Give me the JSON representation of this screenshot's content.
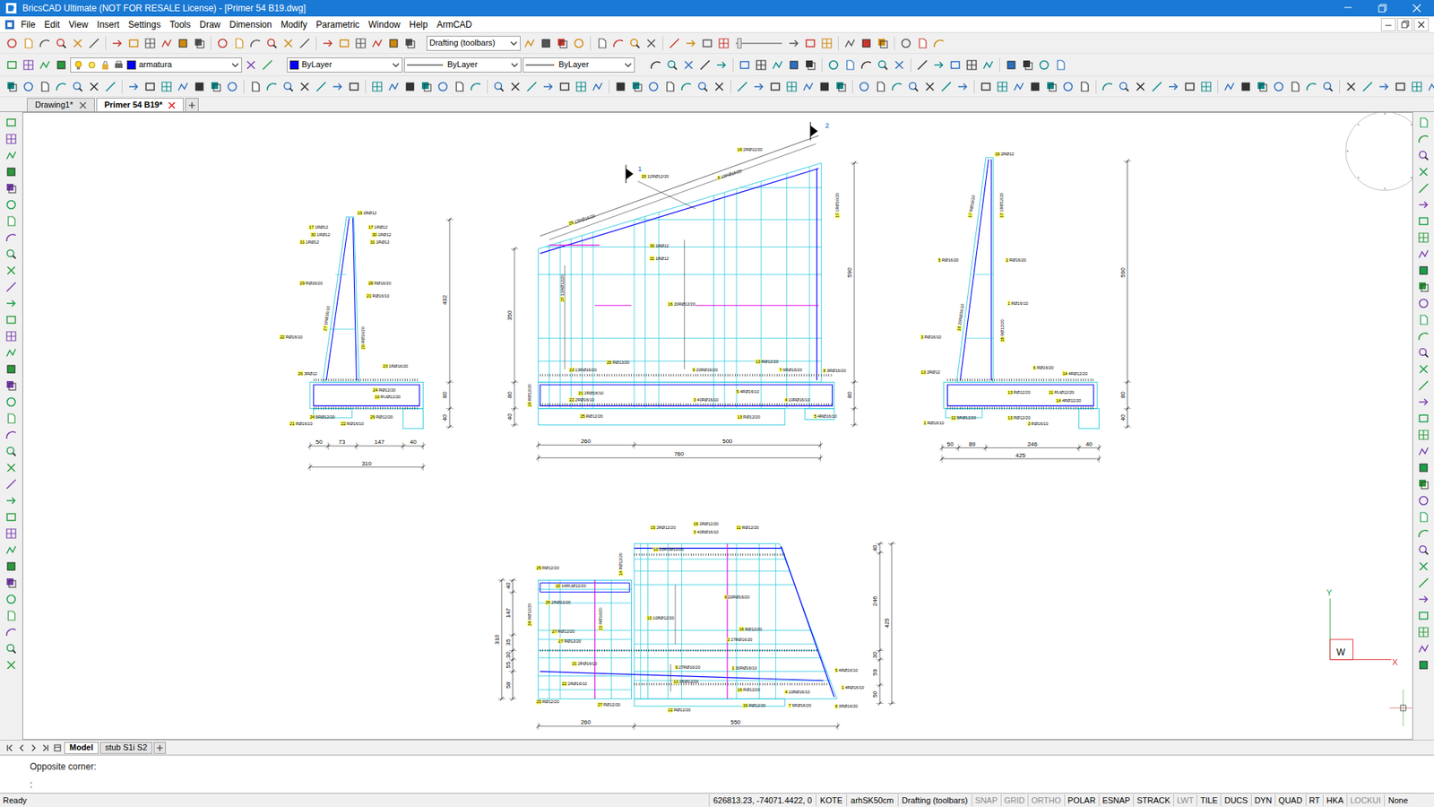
{
  "window": {
    "title": "BricsCAD Ultimate (NOT FOR RESALE License) - [Primer 54 B19.dwg]"
  },
  "menu": [
    "File",
    "Edit",
    "View",
    "Insert",
    "Settings",
    "Tools",
    "Draw",
    "Dimension",
    "Modify",
    "Parametric",
    "Window",
    "Help",
    "ArmCAD"
  ],
  "toolbar": {
    "workspace": "Drafting (toolbars)",
    "layer": "armatura",
    "color": "ByLayer",
    "linetype": "ByLayer",
    "lineweight": "ByLayer"
  },
  "doc_tabs": [
    {
      "label": "Drawing1*",
      "selected": false
    },
    {
      "label": "Primer 54 B19*",
      "selected": true
    }
  ],
  "drawing": {
    "rebar_labels": [
      "19 2RØ12",
      "17 1RØ12",
      "17 1RØ12",
      "30 1RØ12",
      "30 1RØ12",
      "31 1RØ12",
      "31 1RØ12",
      "29 RØ16/20",
      "28 RØ16/20",
      "21 RØ16/10",
      "27 1RØ16/10",
      "20 RØ16/20",
      "22 RØ16/10",
      "23 1RØ16/20",
      "26 3RØ12",
      "24 RØ12/20",
      "10 RUØ12/20",
      "24 5RØ12/20",
      "29 RØ12/20",
      "21 RØ16/10",
      "22 RØ16/10",
      "16 2RØ12/20",
      "8 13RØ16/20",
      "20 12RØ12/20",
      "29 13RØ16/20",
      "17 1RØ16/20",
      "30 1RØ12",
      "31 1RØ12",
      "27 13RØ12/20",
      "16 20RØ12/20",
      "25 RØ13/20",
      "13 RØ12/20",
      "23 13RØ16/20",
      "9 20RØ16/20",
      "7 6RØ16/20",
      "8 3RØ16/20",
      "21 2RØ16/10",
      "5 4RØ16/10",
      "22 2RØ16/10",
      "3 40RØ16/10",
      "4 10RØ16/10",
      "25 RØ12/20",
      "13 RØ12/20",
      "5 4RØ16/10",
      "24 RØ12/20",
      "19 2RØ12",
      "17 RØ16/20",
      "17 1RØ12/20",
      "5 RØ16/20",
      "2 RØ16/20",
      "1 RØ16/10",
      "16 20RØ16/10",
      "18 RØ12/20",
      "3 RØ16/10",
      "13 2RØ12",
      "6 RØ16/20",
      "14 4RØ12/20",
      "13 RØ12/20",
      "11 RUØ12/20",
      "14 4RØ12/20",
      "12 5RØ12/20",
      "13 RØ12/20",
      "3 RØ16/10",
      "1 RØ16/10",
      "15 2RØ12/20",
      "16 2RØ12/20",
      "3 40RØ16/10",
      "11 RØ12/20",
      "10 20RUØ12/20",
      "14 RØ12/20",
      "25 RØ12/20",
      "10 14RUØ12/20",
      "26 2RØ12/20",
      "6 20RØ16/20",
      "13 10RØ12/20",
      "16 RØ12/20",
      "2 27RØ16/20",
      "27 RØ12/20",
      "27 RØ12/20",
      "21 2RØ16/10",
      "9 27RØ16/20",
      "1 30RØ16/10",
      "22 2RØ16/10",
      "13 2RØ12/20",
      "16 RØ12/20",
      "4 10RØ16/10",
      "5 4RØ16/10",
      "1 4RØ16/10",
      "7 6RØ16/20",
      "8 3RØ16/20",
      "25 RØ12/20",
      "27 RØ12/20",
      "12 RØ12/20",
      "16 RØ12/20",
      "24 RØ12/20",
      "23 RØ16/20"
    ],
    "dimensions": [
      "432",
      "80",
      "40",
      "50",
      "73",
      "147",
      "40",
      "310",
      "350",
      "80",
      "40",
      "590",
      "80",
      "260",
      "500",
      "760",
      "590",
      "80",
      "40",
      "50",
      "89",
      "246",
      "40",
      "425",
      "40",
      "147",
      "35",
      "30",
      "55",
      "58",
      "310",
      "40",
      "246",
      "30",
      "59",
      "50",
      "425",
      "260",
      "550"
    ],
    "section_marks": [
      "1",
      "2"
    ],
    "ucs": {
      "y": "Y",
      "x": "X",
      "w": "W"
    }
  },
  "layout_tabs": [
    {
      "label": "Model",
      "selected": true
    },
    {
      "label": "stub S1i S2",
      "selected": false
    }
  ],
  "command": {
    "history": "Opposite corner:",
    "prompt": ":"
  },
  "status_bar": {
    "message": "Ready",
    "coords": "626813.23, -74071.4422, 0",
    "dimstyle": "KOTE",
    "textstyle": "arhSK50cm",
    "workspace": "Drafting (toolbars)",
    "toggles": [
      {
        "label": "SNAP",
        "on": false
      },
      {
        "label": "GRID",
        "on": false
      },
      {
        "label": "ORTHO",
        "on": false
      },
      {
        "label": "POLAR",
        "on": true
      },
      {
        "label": "ESNAP",
        "on": true
      },
      {
        "label": "STRACK",
        "on": true
      },
      {
        "label": "LWT",
        "on": false
      },
      {
        "label": "TILE",
        "on": true
      },
      {
        "label": "DUCS",
        "on": true
      },
      {
        "label": "DYN",
        "on": true
      },
      {
        "label": "QUAD",
        "on": true
      },
      {
        "label": "RT",
        "on": true
      },
      {
        "label": "HKA",
        "on": true
      },
      {
        "label": "LOCKUI",
        "on": false
      }
    ],
    "unit": "None"
  }
}
